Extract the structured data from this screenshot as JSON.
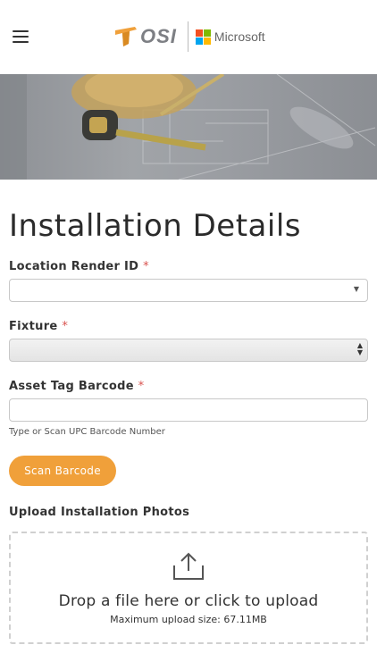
{
  "header": {
    "osi_logo_text": "OSI",
    "microsoft_text": "Microsoft",
    "microsoft_colors": [
      "#f25022",
      "#7fba00",
      "#00a4ef",
      "#ffb900"
    ],
    "osi_accent": "#f0a03a"
  },
  "page": {
    "title": "Installation Details"
  },
  "form": {
    "required_mark": "*",
    "location": {
      "label": "Location Render ID",
      "value": ""
    },
    "fixture": {
      "label": "Fixture",
      "value": ""
    },
    "asset_tag": {
      "label": "Asset Tag Barcode",
      "value": "",
      "hint": "Type or Scan UPC Barcode Number"
    },
    "scan_button": "Scan Barcode",
    "upload": {
      "label": "Upload Installation Photos",
      "drop_text": "Drop a file here or click to upload",
      "max_size_text": "Maximum upload size: 67.11MB"
    }
  },
  "icons": {
    "menu": "hamburger-menu-icon",
    "upload": "upload-icon",
    "select_caret": "caret-down-icon"
  },
  "colors": {
    "accent": "#f0a03a",
    "required": "#d9534f"
  }
}
